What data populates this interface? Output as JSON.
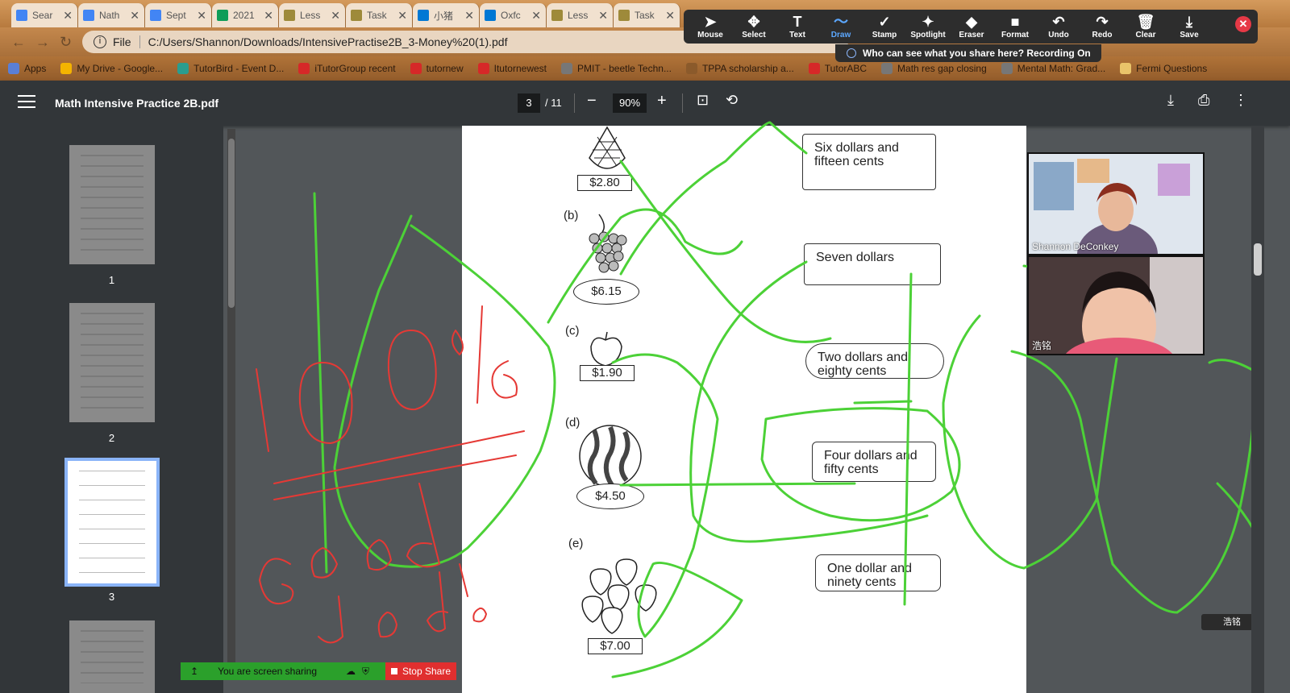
{
  "tabs": [
    {
      "label": "Sear",
      "icon": "google-drive-icon",
      "color": "#4285f4"
    },
    {
      "label": "Nath",
      "icon": "google-docs-icon",
      "color": "#4285f4"
    },
    {
      "label": "Sept",
      "icon": "google-docs-icon",
      "color": "#4285f4"
    },
    {
      "label": "2021",
      "icon": "google-sheets-icon",
      "color": "#0f9d58"
    },
    {
      "label": "Less",
      "icon": "doc-icon",
      "color": "#9e8a3a"
    },
    {
      "label": "Task",
      "icon": "doc-icon",
      "color": "#9e8a3a"
    },
    {
      "label": "小猪",
      "icon": "onedrive-icon",
      "color": "#0078d4"
    },
    {
      "label": "Oxfc",
      "icon": "onedrive-icon",
      "color": "#0078d4"
    },
    {
      "label": "Less",
      "icon": "doc-icon",
      "color": "#9e8a3a"
    },
    {
      "label": "Task",
      "icon": "doc-icon",
      "color": "#9e8a3a"
    }
  ],
  "address": {
    "prefix": "File",
    "url": "C:/Users/Shannon/Downloads/IntensivePractise2B_3-Money%20(1).pdf"
  },
  "bookmarks": [
    {
      "label": "Apps",
      "color": "#5a7fd6"
    },
    {
      "label": "My Drive - Google...",
      "color": "#f4b400"
    },
    {
      "label": "TutorBird - Event D...",
      "color": "#2a9d8f"
    },
    {
      "label": "iTutorGroup recent",
      "color": "#d62828"
    },
    {
      "label": "tutornew",
      "color": "#d62828"
    },
    {
      "label": "Itutornewest",
      "color": "#d62828"
    },
    {
      "label": "PMIT - beetle Techn...",
      "color": "#777777"
    },
    {
      "label": "TPPA scholarship a...",
      "color": "#8b5a2b"
    },
    {
      "label": "TutorABC",
      "color": "#d62828"
    },
    {
      "label": "Math res gap closing",
      "color": "#777777"
    },
    {
      "label": "Mental Math: Grad...",
      "color": "#777777"
    },
    {
      "label": "Fermi Questions",
      "color": "#e9c46a"
    }
  ],
  "pdf": {
    "title": "Math Intensive Practice 2B.pdf",
    "page": "3",
    "total": "/ 11",
    "zoom": "90%",
    "zoom_out": "−",
    "zoom_in": "+"
  },
  "thumbnails": [
    "1",
    "2",
    "3"
  ],
  "worksheet": {
    "items": [
      {
        "letter": "",
        "price": "$2.80"
      },
      {
        "letter": "(b)",
        "price": "$6.15"
      },
      {
        "letter": "(c)",
        "price": "$1.90"
      },
      {
        "letter": "(d)",
        "price": "$4.50"
      },
      {
        "letter": "(e)",
        "price": "$7.00"
      }
    ],
    "words": [
      "Six dollars and fifteen cents",
      "Seven dollars",
      "Two dollars and eighty cents",
      "Four dollars and fifty cents",
      "One dollar and ninety cents"
    ]
  },
  "zoom_toolbar": {
    "tools": [
      {
        "label": "Mouse",
        "icon": "cursor-icon",
        "glyph": "➤"
      },
      {
        "label": "Select",
        "icon": "move-icon",
        "glyph": "✥"
      },
      {
        "label": "Text",
        "icon": "text-icon",
        "glyph": "T"
      },
      {
        "label": "Draw",
        "icon": "draw-icon",
        "glyph": "〜"
      },
      {
        "label": "Stamp",
        "icon": "check-icon",
        "glyph": "✓"
      },
      {
        "label": "Spotlight",
        "icon": "spotlight-icon",
        "glyph": "✦"
      },
      {
        "label": "Eraser",
        "icon": "eraser-icon",
        "glyph": "◆"
      },
      {
        "label": "Format",
        "icon": "format-icon",
        "glyph": "■"
      },
      {
        "label": "Undo",
        "icon": "undo-icon",
        "glyph": "↶"
      },
      {
        "label": "Redo",
        "icon": "redo-icon",
        "glyph": "↷"
      },
      {
        "label": "Clear",
        "icon": "trash-icon",
        "glyph": "🗑"
      },
      {
        "label": "Save",
        "icon": "save-icon",
        "glyph": "⤓"
      }
    ],
    "active": "Draw",
    "close": "✕",
    "banner": "Who can see what you share here? Recording On"
  },
  "participants": [
    {
      "name": "Shannon DeConkey"
    },
    {
      "name": "浩铭"
    }
  ],
  "name_chip": "浩铭",
  "share": {
    "status": "You are screen sharing",
    "stop": "Stop Share"
  },
  "annotations": {
    "red_text": [
      "100",
      "16",
      "Good",
      "Job"
    ]
  },
  "colors": {
    "ink_green": "#4cd137",
    "ink_red": "#e53935",
    "accent": "#8ab4f8"
  }
}
